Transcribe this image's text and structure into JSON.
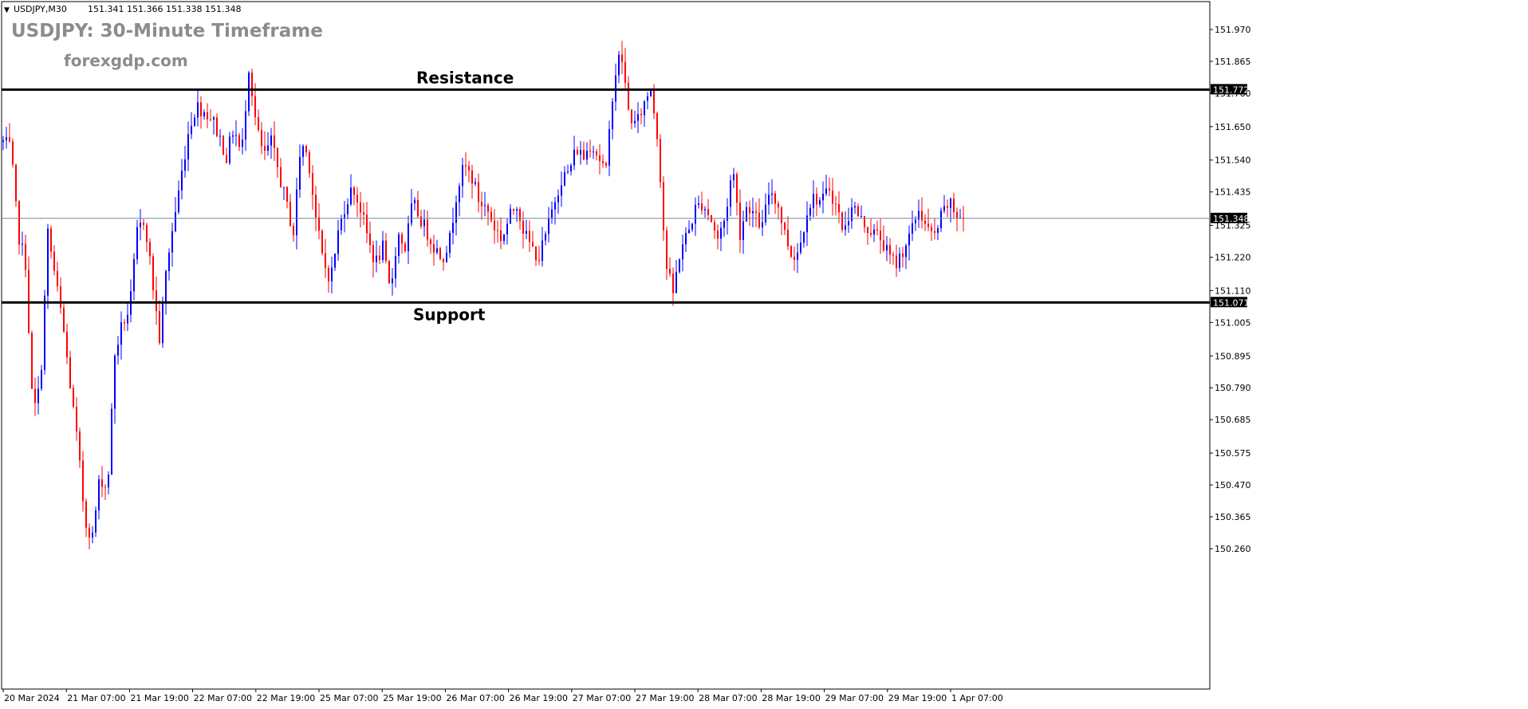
{
  "header": {
    "symbol_line": "USDJPY,M30",
    "ohlc_line": "151.341 151.366 151.338 151.348"
  },
  "overlay": {
    "title": "USDJPY: 30-Minute Timeframe",
    "site": "forexgdp.com",
    "resistance_label": "Resistance",
    "support_label": "Support"
  },
  "colors": {
    "bull": "#0000ff",
    "bear": "#ff0000",
    "levels": "#000000",
    "grid_text": "#000000",
    "current_price_line": "#778899"
  },
  "chart_data": {
    "type": "candlestick",
    "symbol": "USDJPY",
    "timeframe": "M30",
    "current_price": 151.348,
    "ylim": [
      150.2,
      152.05
    ],
    "y_ticks": [
      151.97,
      151.865,
      151.76,
      151.65,
      151.54,
      151.435,
      151.325,
      151.22,
      151.11,
      151.005,
      150.895,
      150.79,
      150.685,
      150.575,
      150.47,
      150.365,
      150.26
    ],
    "x_ticks": [
      "20 Mar 2024",
      "21 Mar 07:00",
      "21 Mar 19:00",
      "22 Mar 07:00",
      "22 Mar 19:00",
      "25 Mar 07:00",
      "25 Mar 19:00",
      "26 Mar 07:00",
      "26 Mar 19:00",
      "27 Mar 07:00",
      "27 Mar 19:00",
      "28 Mar 07:00",
      "28 Mar 19:00",
      "29 Mar 07:00",
      "29 Mar 19:00",
      "1 Apr 07:00"
    ],
    "levels": [
      {
        "label": "Resistance",
        "value": 151.772
      },
      {
        "label": "Support",
        "value": 151.071
      }
    ],
    "price_path": [
      151.6,
      151.58,
      151.3,
      151.2,
      150.7,
      150.8,
      151.3,
      151.15,
      151.0,
      150.8,
      150.6,
      150.35,
      150.3,
      150.5,
      150.45,
      150.9,
      151.0,
      151.05,
      151.3,
      151.35,
      151.15,
      150.95,
      151.2,
      151.35,
      151.5,
      151.65,
      151.72,
      151.7,
      151.68,
      151.62,
      151.55,
      151.65,
      151.55,
      151.85,
      151.65,
      151.55,
      151.6,
      151.5,
      151.4,
      151.3,
      151.6,
      151.55,
      151.35,
      151.2,
      151.15,
      151.3,
      151.4,
      151.45,
      151.38,
      151.28,
      151.2,
      151.25,
      151.1,
      151.3,
      151.25,
      151.4,
      151.35,
      151.3,
      151.25,
      151.22,
      151.28,
      151.45,
      151.52,
      151.48,
      151.4,
      151.38,
      151.32,
      151.28,
      151.35,
      151.4,
      151.3,
      151.25,
      151.22,
      151.3,
      151.4,
      151.48,
      151.5,
      151.58,
      151.55,
      151.6,
      151.55,
      151.5,
      151.8,
      151.9,
      151.7,
      151.65,
      151.72,
      151.78,
      151.6,
      151.2,
      151.1,
      151.25,
      151.3,
      151.38,
      151.4,
      151.35,
      151.28,
      151.35,
      151.52,
      151.3,
      151.4,
      151.35,
      151.32,
      151.45,
      151.4,
      151.3,
      151.22,
      151.25,
      151.38,
      151.42,
      151.4,
      151.45,
      151.38,
      151.3,
      151.4,
      151.35,
      151.32,
      151.3,
      151.28,
      151.22,
      151.2,
      151.25,
      151.3,
      151.38,
      151.32,
      151.28,
      151.35,
      151.4,
      151.36,
      151.35
    ]
  }
}
